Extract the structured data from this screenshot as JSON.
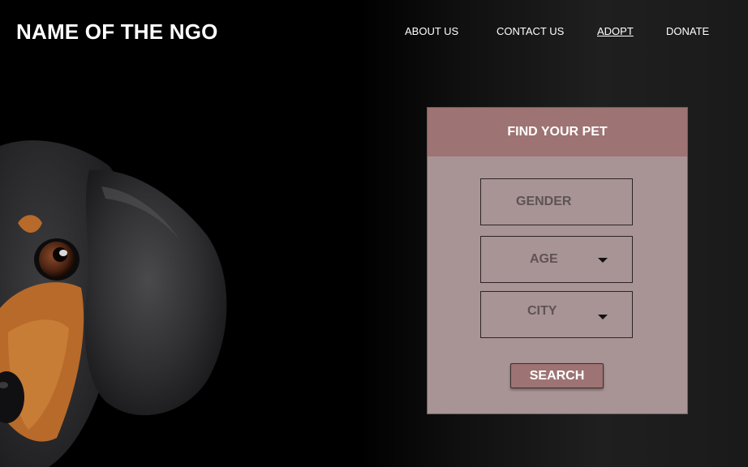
{
  "brand": {
    "name": "NAME OF THE NGO"
  },
  "nav": {
    "about": "ABOUT US",
    "contact": "CONTACT US",
    "adopt": "ADOPT",
    "donate": "DONATE"
  },
  "hero": {
    "image": "dachshund-dog-photo"
  },
  "finder": {
    "title": "FIND YOUR PET",
    "gender": {
      "label": "GENDER"
    },
    "age": {
      "label": "AGE",
      "icon": "caret-down-icon"
    },
    "city": {
      "label": "CITY",
      "icon": "caret-down-icon"
    },
    "search_label": "SEARCH"
  },
  "colors": {
    "panel_bg": "#a99495",
    "header_bg": "#9e7373",
    "page_bg": "#000000"
  }
}
